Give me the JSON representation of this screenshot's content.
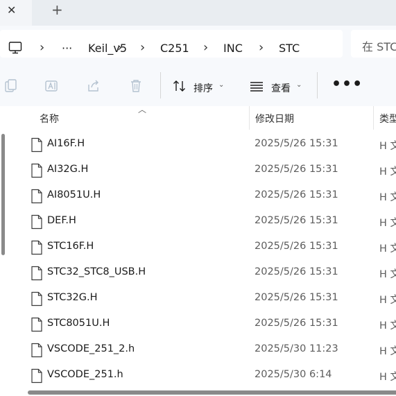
{
  "tabs": {
    "close_glyph": "✕",
    "edge_glyph": "\\",
    "new_tab_glyph": "+"
  },
  "breadcrumb": {
    "overflow": "···",
    "items": [
      "Keil_v5",
      "C251",
      "INC",
      "STC"
    ],
    "separator": "›"
  },
  "search": {
    "placeholder": "在 STC"
  },
  "toolbar": {
    "sort_label": "排序",
    "view_label": "查看",
    "more_label": "•••",
    "chevron": "⌄"
  },
  "columns": {
    "name": "名称",
    "modified": "修改日期",
    "type": "类型"
  },
  "files": [
    {
      "name": "AI16F.H",
      "modified": "2025/5/26 15:31",
      "type": "H 文"
    },
    {
      "name": "AI32G.H",
      "modified": "2025/5/26 15:31",
      "type": "H 文"
    },
    {
      "name": "AI8051U.H",
      "modified": "2025/5/26 15:31",
      "type": "H 文"
    },
    {
      "name": "DEF.H",
      "modified": "2025/5/26 15:31",
      "type": "H 文"
    },
    {
      "name": "STC16F.H",
      "modified": "2025/5/26 15:31",
      "type": "H 文"
    },
    {
      "name": "STC32_STC8_USB.H",
      "modified": "2025/5/26 15:31",
      "type": "H 文"
    },
    {
      "name": "STC32G.H",
      "modified": "2025/5/26 15:31",
      "type": "H 文"
    },
    {
      "name": "STC8051U.H",
      "modified": "2025/5/26 15:31",
      "type": "H 文"
    },
    {
      "name": "VSCODE_251_2.h",
      "modified": "2025/5/30 11:23",
      "type": "H 文"
    },
    {
      "name": "VSCODE_251.h",
      "modified": "2025/5/30 6:14",
      "type": "H 文"
    }
  ],
  "colors": {
    "accent": "#0067c0",
    "toolbar_bg": "#f7f9fc",
    "tab_bg": "#e9edf1"
  }
}
